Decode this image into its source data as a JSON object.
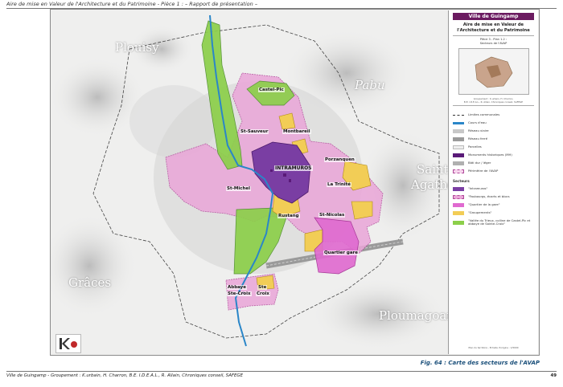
{
  "header": "Aire de mise en Valeur de l'Architecture et du Patrimoine - Pièce 1 : – Rapport de présentation –",
  "map": {
    "place_labels": {
      "plouisy": "Plouisy",
      "pabu": "Pabu",
      "saint_agathon_1": "Saint",
      "saint_agathon_2": "Agathon",
      "graces": "Grâces",
      "ploumagoar": "Ploumagoar"
    },
    "sector_labels": {
      "castel_pic": "Castel-Pic",
      "st_sauveur": "St-Sauveur",
      "montbareil": "Montbareil",
      "intramuros": "INTRAMUROS",
      "porzanquen": "Porzanquen",
      "st_michel": "St-Michel",
      "la_trinite": "La Trinité",
      "rustang": "Rustang",
      "st_nicolas": "St-Nicolas",
      "quartier_gare": "Quartier gare",
      "abbaye_1": "Abbaye",
      "abbaye_2": "Ste-Croix",
      "ste_croix_1": "Ste",
      "ste_croix_2": "Croix"
    }
  },
  "legend": {
    "title": "Ville de Guingamp",
    "subtitle_1": "Aire de mise en Valeur de",
    "subtitle_2": "l'Architecture et du Patrimoine",
    "piece_1": "Pièce 3 - Plan 1.2 :",
    "piece_2": "Secteurs de l'AVAP",
    "credit_1": "Groupement : K.urbain, H. Charron,",
    "credit_2": "B.E. I.D.E.A.L., R. Allain, Chroniques conseil, SAFEGE",
    "items": [
      {
        "label": "Limites communales"
      },
      {
        "label": "Cours d'eau"
      },
      {
        "label": "Réseau viaire"
      },
      {
        "label": "Réseau ferré"
      },
      {
        "label": "Parcelles"
      },
      {
        "label": "Monuments historiques (MH)"
      },
      {
        "label": "Bâti dur / léger"
      },
      {
        "label": "Périmètre de l'AVAP"
      }
    ],
    "sectors_title": "Secteurs",
    "sectors": [
      {
        "label": "\"Intramuros\""
      },
      {
        "label": "\"Faubourgs, écarts et blocs"
      },
      {
        "label": "\"Quartier de la gare\""
      },
      {
        "label": "\"Groupements\""
      },
      {
        "label": "\"Vallée du Trieux, colline de Castel-Pic et abbaye de Sainte-Croix\""
      }
    ],
    "scale": "Plan du territoire - Echelle d'origine : 1/5000"
  },
  "caption": "Fig. 64 : Carte des secteurs de l'AVAP",
  "footer": "Ville de Guingamp - Groupement : K.urbain, H. Charron, B.E. I.D.E.A.L., R. Allain, Chroniques conseil, SAFEGE",
  "page_number": "49",
  "colors": {
    "intramuros": "#7a3ea3",
    "faubourgs": "#eaa6d8",
    "gare": "#e06ad0",
    "groupements": "#f2cd56",
    "vallee": "#8ccf4a",
    "river": "#2a86c8",
    "mh": "#5a1a78"
  }
}
